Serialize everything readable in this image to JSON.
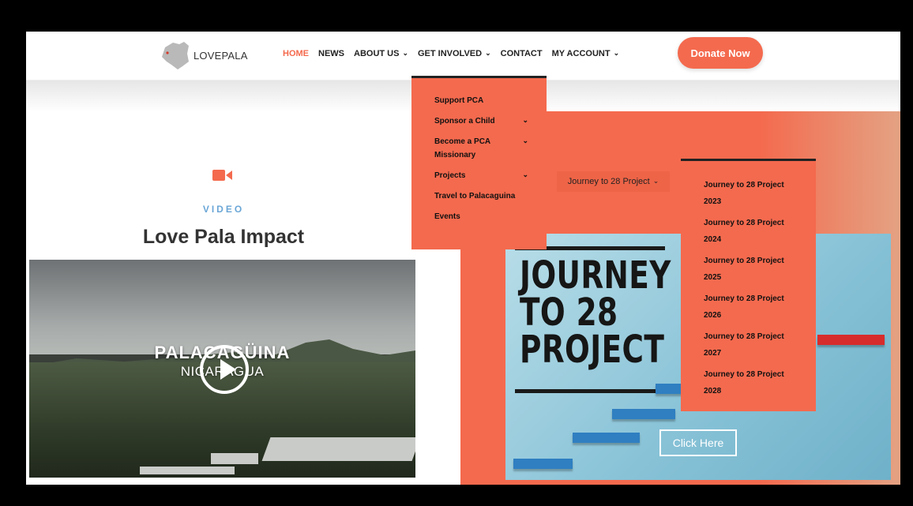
{
  "brand": {
    "name": "LOVEPALA"
  },
  "nav": {
    "items": [
      {
        "label": "HOME",
        "active": true,
        "has_dropdown": false
      },
      {
        "label": "NEWS",
        "active": false,
        "has_dropdown": false
      },
      {
        "label": "ABOUT US",
        "active": false,
        "has_dropdown": true
      },
      {
        "label": "GET INVOLVED",
        "active": false,
        "has_dropdown": true
      },
      {
        "label": "CONTACT",
        "active": false,
        "has_dropdown": false
      },
      {
        "label": "MY ACCOUNT",
        "active": false,
        "has_dropdown": true
      }
    ],
    "donate_label": "Donate Now"
  },
  "get_involved_menu": {
    "items": [
      {
        "label": "Support PCA",
        "has_submenu": false
      },
      {
        "label": "Sponsor a Child",
        "has_submenu": true
      },
      {
        "label": "Become a PCA Missionary",
        "has_submenu": true
      },
      {
        "label": "Projects",
        "has_submenu": true
      },
      {
        "label": "Travel to Palacaguina",
        "has_submenu": false
      },
      {
        "label": "Events",
        "has_submenu": false
      }
    ]
  },
  "projects_submenu": {
    "parent_label": "Journey to 28 Project",
    "items": [
      "Journey to 28 Project 2023",
      "Journey to 28 Project 2024",
      "Journey to 28 Project 2025",
      "Journey to 28 Project 2026",
      "Journey to 28 Project 2027",
      "Journey to 28 Project 2028"
    ]
  },
  "video_section": {
    "eyebrow": "VIDEO",
    "title": "Love Pala Impact",
    "thumbnail": {
      "title": "PALACAGÜINA",
      "subtitle": "NICARAGUA"
    }
  },
  "promo": {
    "lines": [
      "JOURNEY",
      "TO 28",
      "PROJECT"
    ],
    "button_label": "Click Here"
  },
  "colors": {
    "accent": "#f46a4e",
    "eyebrow": "#6aa6d6",
    "dark": "#222222"
  },
  "icons": {
    "video": "video-camera-icon",
    "play": "play-icon",
    "chevron": "chevron-down-icon"
  }
}
